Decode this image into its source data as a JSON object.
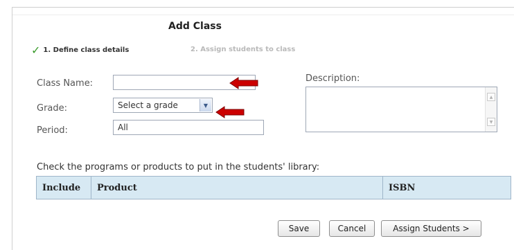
{
  "page": {
    "title": "Add Class",
    "steps": [
      {
        "label": "1. Define class details"
      },
      {
        "label": "2. Assign students to class"
      }
    ]
  },
  "form": {
    "class_name_label": "Class Name:",
    "class_name_value": "",
    "grade_label": "Grade:",
    "grade_selected": "Select a grade",
    "period_label": "Period:",
    "period_value": "All",
    "description_label": "Description:",
    "description_value": ""
  },
  "products": {
    "instruction": "Check the programs or products to put in the students' library:",
    "columns": [
      "Include",
      "Product",
      "ISBN"
    ]
  },
  "buttons": {
    "save": "Save",
    "cancel": "Cancel",
    "assign": "Assign Students >"
  },
  "colors": {
    "checkmark": "#3a9b2c",
    "arrow_annotation": "#cc0000",
    "table_header_bg": "#d7e9f3"
  }
}
